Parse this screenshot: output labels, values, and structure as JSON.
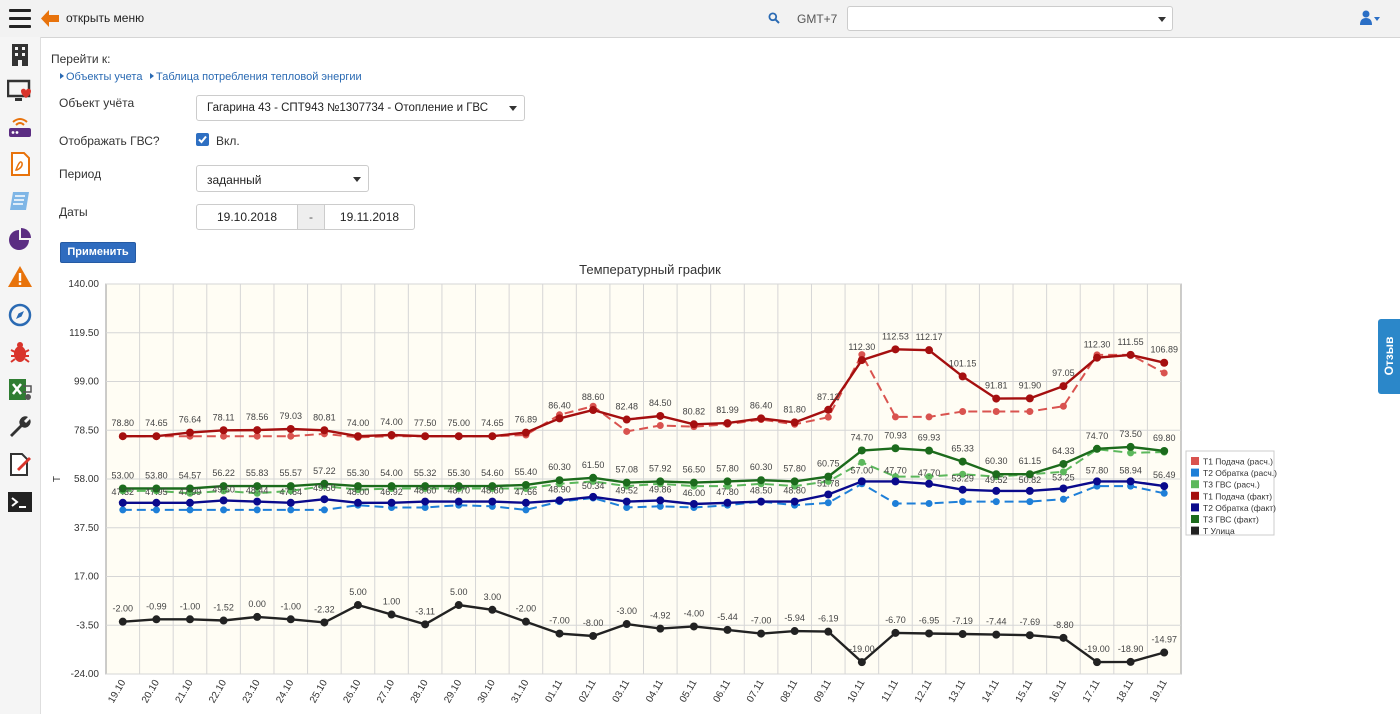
{
  "topbar": {
    "menu_label": "открыть меню",
    "timezone_label": "GMT+7",
    "timezone_value": "",
    "icons": [
      "menu-icon",
      "back-arrow-icon",
      "search-icon",
      "chevron-down-icon",
      "user-icon"
    ]
  },
  "sidebar": {
    "icons": [
      "building-icon",
      "monitor-heart-icon",
      "router-icon",
      "pdf-icon",
      "notebook-icon",
      "pie-chart-icon",
      "warning-icon",
      "compass-icon",
      "bug-icon",
      "excel-icon",
      "wrench-icon",
      "edit-document-icon",
      "terminal-icon"
    ],
    "colors": {
      "orange": "#e8730c",
      "purple": "#5b2d82",
      "dark": "#333333",
      "red": "#d9342b"
    }
  },
  "form": {
    "goto_label": "Перейти к:",
    "links": [
      "Объекты учета",
      "Таблица потребления тепловой энергии"
    ],
    "object_label": "Объект учёта",
    "object_value": "Гагарина 43 - СПТ943 №1307734 - Отопление и ГВС",
    "show_gvs_label": "Отображать ГВС?",
    "show_gvs_checked": true,
    "show_gvs_value": "Вкл.",
    "period_label": "Период",
    "period_value": "заданный",
    "dates_label": "Даты",
    "date_from": "19.10.2018",
    "date_sep": "-",
    "date_to": "19.11.2018",
    "apply_label": "Применить"
  },
  "feedback_label": "Отзыв",
  "chart_data": {
    "type": "line",
    "title": "Температурный график",
    "ylabel": "T",
    "xlabel": "",
    "ylim": [
      -24,
      140
    ],
    "yticks": [
      "140.00",
      "119.50",
      "99.00",
      "78.50",
      "58.00",
      "37.50",
      "17.00",
      "-3.50",
      "-24.00"
    ],
    "grid": true,
    "legend_position": "right",
    "categories": [
      "19.10",
      "20.10",
      "21.10",
      "22.10",
      "23.10",
      "24.10",
      "25.10",
      "26.10",
      "27.10",
      "28.10",
      "29.10",
      "30.10",
      "31.10",
      "01.11",
      "02.11",
      "03.11",
      "04.11",
      "05.11",
      "06.11",
      "07.11",
      "08.11",
      "09.11",
      "10.11",
      "11.11",
      "12.11",
      "13.11",
      "14.11",
      "15.11",
      "16.11",
      "17.11",
      "18.11",
      "19.11"
    ],
    "series": [
      {
        "name": "Т1 Подача (расч.)",
        "color": "#d9534f",
        "dashed": true,
        "values": [
          76.0,
          76.0,
          76.0,
          76.0,
          76.0,
          76.0,
          77.0,
          75.5,
          76.0,
          76.0,
          76.0,
          76.0,
          76.5,
          85.0,
          88.6,
          78.0,
          80.5,
          80.0,
          81.0,
          83.0,
          81.0,
          84.0,
          110.3,
          84.1,
          84.1,
          86.4,
          86.4,
          86.4,
          88.6,
          110.2,
          110.2,
          102.6
        ]
      },
      {
        "name": "Т2 Обратка (расч.)",
        "color": "#1e7fd8",
        "dashed": true,
        "values": [
          45.0,
          45.0,
          45.0,
          45.0,
          45.0,
          45.0,
          45.0,
          47.0,
          46.0,
          46.0,
          47.0,
          46.5,
          45.0,
          48.5,
          50.0,
          46.0,
          46.5,
          46.0,
          47.0,
          48.5,
          47.0,
          48.0,
          56.0,
          47.7,
          47.7,
          48.5,
          48.5,
          48.5,
          49.5,
          55.0,
          55.0,
          52.0
        ]
      },
      {
        "name": "Т3 ГВС (расч.)",
        "color": "#5cb85c",
        "dashed": true,
        "values": [
          53.0,
          53.0,
          52.0,
          53.0,
          52.0,
          53.0,
          55.0,
          53.5,
          54.0,
          54.0,
          54.0,
          54.0,
          54.0,
          56.0,
          57.0,
          55.0,
          56.0,
          55.0,
          55.0,
          56.0,
          55.0,
          57.0,
          65.0,
          59.0,
          59.0,
          60.0,
          59.0,
          60.0,
          61.0,
          70.5,
          69.0,
          69.3
        ]
      },
      {
        "name": "Т1 Подача (факт)",
        "color": "#a50f0f",
        "dashed": false,
        "values": [
          76.0,
          76.0,
          77.5,
          78.5,
          78.56,
          79.03,
          78.5,
          76.0,
          76.5,
          76.0,
          76.0,
          76.0,
          77.5,
          83.5,
          87.0,
          83.0,
          84.5,
          81.0,
          81.5,
          83.5,
          81.8,
          87.1,
          108.0,
          112.53,
          112.17,
          101.15,
          91.81,
          91.9,
          97.05,
          109.0,
          110.2,
          106.89
        ]
      },
      {
        "name": "Т2 Обратка (факт)",
        "color": "#0a0a8c",
        "dashed": false,
        "values": [
          48.0,
          48.0,
          48.0,
          49.0,
          48.5,
          48.0,
          49.5,
          48.0,
          48.0,
          48.5,
          48.5,
          48.5,
          48.0,
          49.0,
          50.5,
          48.5,
          49.0,
          47.5,
          48.0,
          48.5,
          48.5,
          51.5,
          57.0,
          57.0,
          56.0,
          53.5,
          53.0,
          53.0,
          54.0,
          57.0,
          57.0,
          55.0
        ]
      },
      {
        "name": "Т3 ГВС (факт)",
        "color": "#1c6b1c",
        "dashed": false,
        "values": [
          54.0,
          54.0,
          54.0,
          55.0,
          55.0,
          55.0,
          56.0,
          55.0,
          55.0,
          55.0,
          55.0,
          55.0,
          55.5,
          57.5,
          58.5,
          56.5,
          57.0,
          56.5,
          57.0,
          57.5,
          57.0,
          59.0,
          70.0,
          70.93,
          69.93,
          65.33,
          60.0,
          60.0,
          64.33,
          70.7,
          71.5,
          69.8
        ]
      },
      {
        "name": "Т Улица",
        "color": "#222222",
        "dashed": false,
        "values": [
          -2.0,
          -0.99,
          -1.0,
          -1.52,
          0.0,
          -1.0,
          -2.32,
          5.0,
          1.0,
          -3.11,
          5.0,
          3.0,
          -2.0,
          -7.0,
          -8.0,
          -3.0,
          -4.92,
          -4.0,
          -5.44,
          -7.0,
          -5.94,
          -6.19,
          -19.0,
          -6.7,
          -6.95,
          -7.19,
          -7.44,
          -7.69,
          -8.8,
          -19.0,
          -18.9,
          -14.97
        ]
      }
    ],
    "data_labels": {
      "Т1 Подача (факт)": [
        "78.80",
        "74.65",
        "76.64",
        "78.11",
        "78.56",
        "79.03",
        "80.81",
        "74.00",
        "74.00",
        "77.50",
        "75.00",
        "74.65",
        "76.89",
        "86.40",
        "88.60",
        "82.48",
        "84.50",
        "80.82",
        "81.99",
        "86.40",
        "81.80",
        "87.12",
        "112.30",
        "112.53",
        "112.17",
        "101.15",
        "91.81",
        "91.90",
        "97.05",
        "112.30",
        "111.55",
        "106.89"
      ],
      "Т Улица": [
        "-2.00",
        "-0.99",
        "-1.00",
        "-1.52",
        "0.00",
        "-1.00",
        "-2.32",
        "5.00",
        "1.00",
        "-3.11",
        "5.00",
        "3.00",
        "-2.00",
        "-7.00",
        "-8.00",
        "-3.00",
        "-4.92",
        "-4.00",
        "-5.44",
        "-7.00",
        "-5.94",
        "-6.19",
        "-19.00",
        "-6.70",
        "-6.95",
        "-7.19",
        "-7.44",
        "-7.69",
        "-8.80",
        "-19.00",
        "-18.90",
        "-14.97"
      ],
      "Т3 ГВС (факт)": [
        "53.00",
        "53.80",
        "54.57",
        "56.22",
        "55.83",
        "55.57",
        "57.22",
        "55.30",
        "54.00",
        "55.32",
        "55.30",
        "54.60",
        "55.40",
        "60.30",
        "61.50",
        "57.08",
        "57.92",
        "56.50",
        "57.80",
        "60.30",
        "57.80",
        "60.75",
        "74.70",
        "70.93",
        "69.93",
        "65.33",
        "60.30",
        "61.15",
        "64.33",
        "74.70",
        "73.50",
        "69.80"
      ],
      "Т2 Обратка (факт)": [
        "47.32",
        "47.95",
        "47.99",
        "49.50",
        "48.44",
        "47.64",
        "49.50",
        "48.00",
        "46.92",
        "48.60",
        "48.70",
        "48.80",
        "47.66",
        "48.90",
        "50.34",
        "49.52",
        "49.86",
        "46.00",
        "47.80",
        "48.50",
        "48.80",
        "51.78",
        "57.00",
        "47.70",
        "47.70",
        "53.29",
        "49.52",
        "50.82",
        "53.25",
        "57.80",
        "58.94",
        "56.49"
      ]
    }
  }
}
